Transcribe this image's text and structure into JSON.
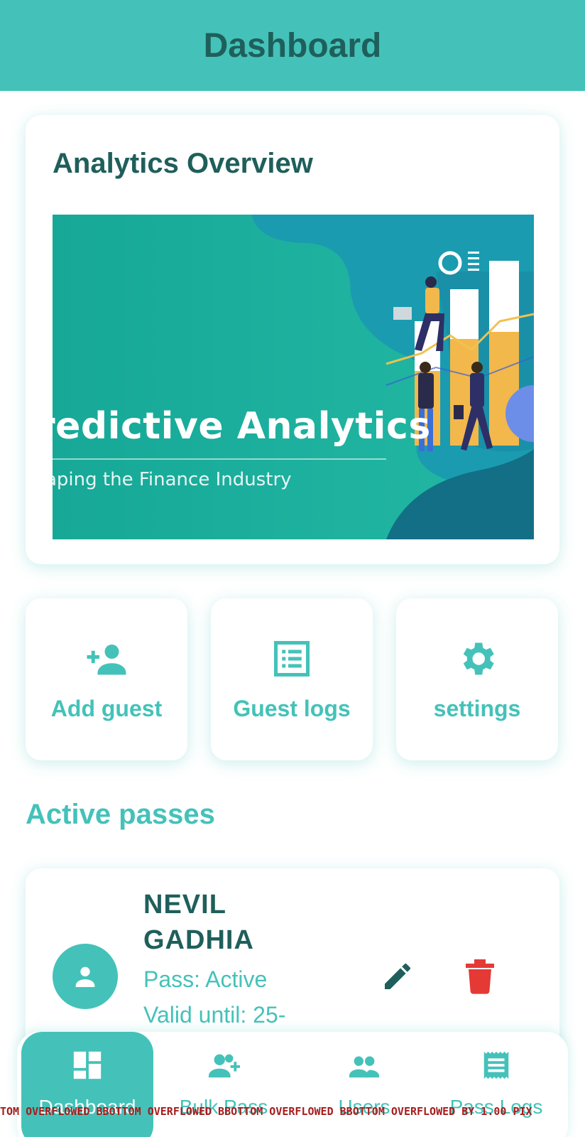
{
  "app_bar": {
    "title": "Dashboard"
  },
  "overview": {
    "title": "Analytics Overview",
    "banner_headline": "redictive Analytics",
    "banner_subtitle": "aping the Finance Industry"
  },
  "actions": [
    {
      "label": "Add guest",
      "icon": "person-add-icon"
    },
    {
      "label": "Guest logs",
      "icon": "list-alt-icon"
    },
    {
      "label": "settings",
      "icon": "gear-icon"
    }
  ],
  "active_passes": {
    "title": "Active passes",
    "items": [
      {
        "name": "NEVIL GADHIA",
        "status": "Pass: Active",
        "valid": "Valid until: 25-"
      }
    ]
  },
  "bottom_nav": [
    {
      "label": "Dashboard",
      "icon": "dashboard-icon",
      "active": true
    },
    {
      "label": "Bulk Pass",
      "icon": "group-add-icon",
      "active": false
    },
    {
      "label": "Users",
      "icon": "people-icon",
      "active": false
    },
    {
      "label": "Pass Logs",
      "icon": "receipt-icon",
      "active": false
    }
  ],
  "debug_overflow": "TOM OVERFLOWED BBOTTOM OVERFLOWED BBOTTOM OVERFLOWED BBOTTOM OVERFLOWED BY 1.00 PIX",
  "colors": {
    "primary": "#44c2b9",
    "primary_dark": "#1f5f5b",
    "danger": "#e53935",
    "overflow_text": "#a51c1c"
  }
}
